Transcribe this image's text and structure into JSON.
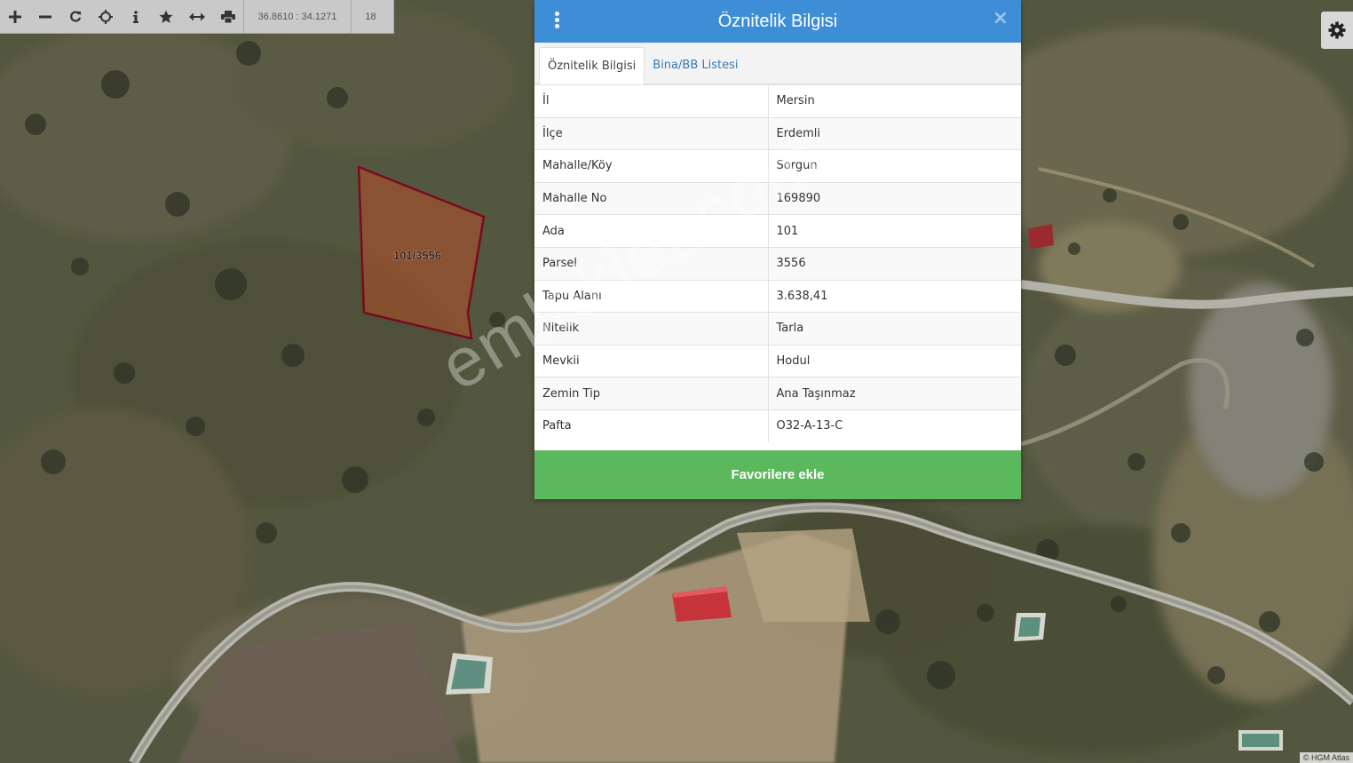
{
  "toolbar": {
    "coords": "36.8610 : 34.1271",
    "zoom": "18"
  },
  "map": {
    "parcel_label": "101/3556",
    "parcel_fill": "#b5502a",
    "parcel_stroke": "#7a0a1e",
    "attribution": "© HGM Atlas"
  },
  "dialog": {
    "title": "Öznitelik Bilgisi",
    "close_glyph": "×",
    "tabs": [
      {
        "label": "Öznitelik Bilgisi"
      },
      {
        "label": "Bina/BB Listesi"
      }
    ],
    "rows": [
      {
        "key": "İl",
        "value": "Mersin"
      },
      {
        "key": "İlçe",
        "value": "Erdemli"
      },
      {
        "key": "Mahalle/Köy",
        "value": "Sorgun"
      },
      {
        "key": "Mahalle No",
        "value": "169890"
      },
      {
        "key": "Ada",
        "value": "101"
      },
      {
        "key": "Parsel",
        "value": "3556"
      },
      {
        "key": "Tapu Alanı",
        "value": "3.638,41"
      },
      {
        "key": "Nitelik",
        "value": "Tarla"
      },
      {
        "key": "Mevkii",
        "value": "Hodul"
      },
      {
        "key": "Zemin Tip",
        "value": "Ana Taşınmaz"
      },
      {
        "key": "Pafta",
        "value": "O32-A-13-C"
      }
    ],
    "favorite_label": "Favorilere ekle",
    "header_color": "#3d8ed6",
    "button_color": "#5cb85c"
  },
  "watermark": "emlakjet.com"
}
